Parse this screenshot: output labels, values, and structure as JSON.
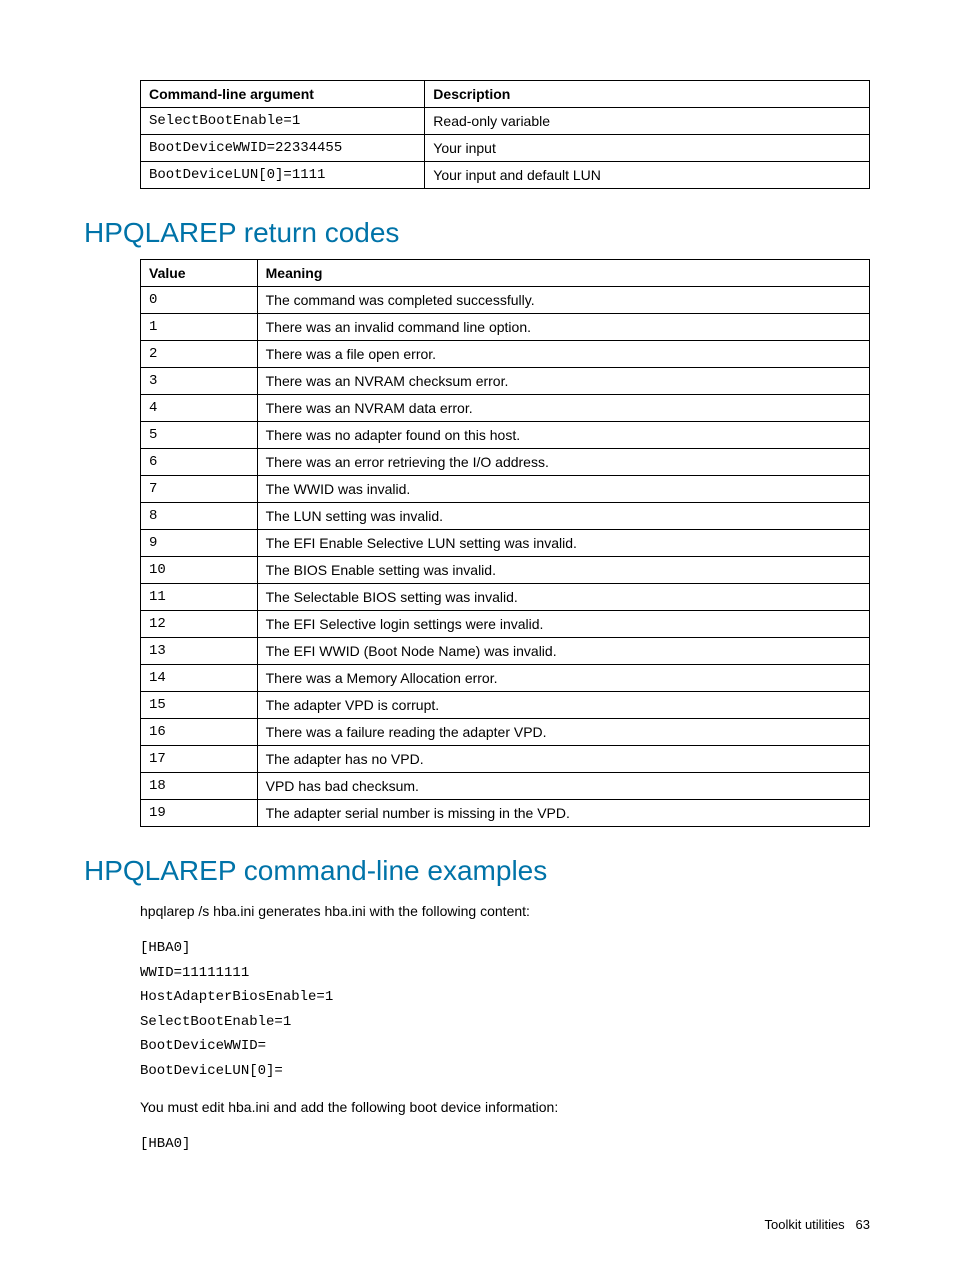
{
  "args_table": {
    "headers": {
      "col1": "Command-line argument",
      "col2": "Description"
    },
    "rows": [
      {
        "arg": "SelectBootEnable=1",
        "desc": "Read-only variable"
      },
      {
        "arg": "BootDeviceWWID=22334455",
        "desc": "Your input"
      },
      {
        "arg": "BootDeviceLUN[0]=1111",
        "desc": "Your input and default LUN"
      }
    ]
  },
  "heading_codes": "HPQLAREP return codes",
  "codes_table": {
    "headers": {
      "col1": "Value",
      "col2": "Meaning"
    },
    "rows": [
      {
        "val": "0",
        "mean": "The command was completed successfully."
      },
      {
        "val": "1",
        "mean": "There was an invalid command line option."
      },
      {
        "val": "2",
        "mean": "There was a file open error."
      },
      {
        "val": "3",
        "mean": "There was an NVRAM checksum error."
      },
      {
        "val": "4",
        "mean": "There was an NVRAM data error."
      },
      {
        "val": "5",
        "mean": "There was no adapter found on this host."
      },
      {
        "val": "6",
        "mean": "There was an error retrieving the I/O address."
      },
      {
        "val": "7",
        "mean": "The WWID was invalid."
      },
      {
        "val": "8",
        "mean": "The LUN setting was invalid."
      },
      {
        "val": "9",
        "mean": "The EFI Enable Selective LUN setting was invalid."
      },
      {
        "val": "10",
        "mean": "The BIOS Enable setting was invalid."
      },
      {
        "val": "11",
        "mean": "The Selectable BIOS setting was invalid."
      },
      {
        "val": "12",
        "mean": "The EFI Selective login settings were invalid."
      },
      {
        "val": "13",
        "mean": "The EFI WWID (Boot Node Name) was invalid."
      },
      {
        "val": "14",
        "mean": "There was a Memory Allocation error."
      },
      {
        "val": "15",
        "mean": "The adapter VPD is corrupt."
      },
      {
        "val": "16",
        "mean": "There was a failure reading the adapter VPD."
      },
      {
        "val": "17",
        "mean": "The adapter has no VPD."
      },
      {
        "val": "18",
        "mean": "VPD has bad checksum."
      },
      {
        "val": "19",
        "mean": "The adapter serial number is missing in the VPD."
      }
    ]
  },
  "heading_examples": "HPQLAREP command-line examples",
  "example_intro": "hpqlarep /s hba.ini generates hba.ini with the following content:",
  "example_block1": "[HBA0]\nWWID=11111111\nHostAdapterBiosEnable=1\nSelectBootEnable=1\nBootDeviceWWID=\nBootDeviceLUN[0]=",
  "example_note": "You must edit hba.ini and add the following boot device information:",
  "example_block2": "[HBA0]",
  "footer": {
    "section": "Toolkit utilities",
    "page": "63"
  }
}
